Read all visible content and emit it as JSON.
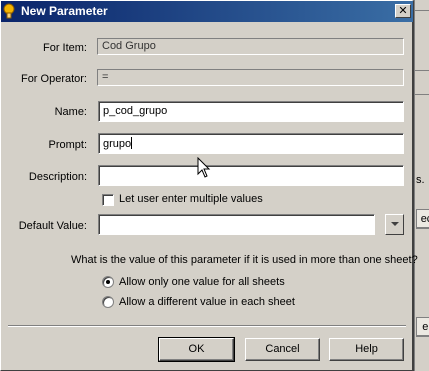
{
  "window": {
    "title": "New Parameter",
    "close_glyph": "✕"
  },
  "form": {
    "for_item": {
      "label": "For Item:",
      "value": "Cod Grupo"
    },
    "for_operator": {
      "label": "For Operator:",
      "value": "="
    },
    "name": {
      "label": "Name:",
      "value": "p_cod_grupo"
    },
    "prompt": {
      "label": "Prompt:",
      "value": "grupo"
    },
    "description": {
      "label": "Description:",
      "value": ""
    },
    "multiple_values": {
      "label": "Let user enter multiple values",
      "checked": false
    },
    "default_value": {
      "label": "Default Value:",
      "value": ""
    }
  },
  "scope": {
    "question": "What is the value of this parameter if it is used in more than one sheet?",
    "options": [
      {
        "label": "Allow only one value for all sheets",
        "selected": true
      },
      {
        "label": "Allow a different value in each sheet",
        "selected": false
      }
    ]
  },
  "buttons": {
    "ok": "OK",
    "cancel": "Cancel",
    "help": "Help"
  },
  "background_window": {
    "fragments": [
      "s.",
      "ec",
      "el"
    ]
  },
  "icons": {
    "title": "parameter-icon",
    "dropdown": "chevron-down-icon",
    "pointer": "mouse-pointer-icon"
  }
}
